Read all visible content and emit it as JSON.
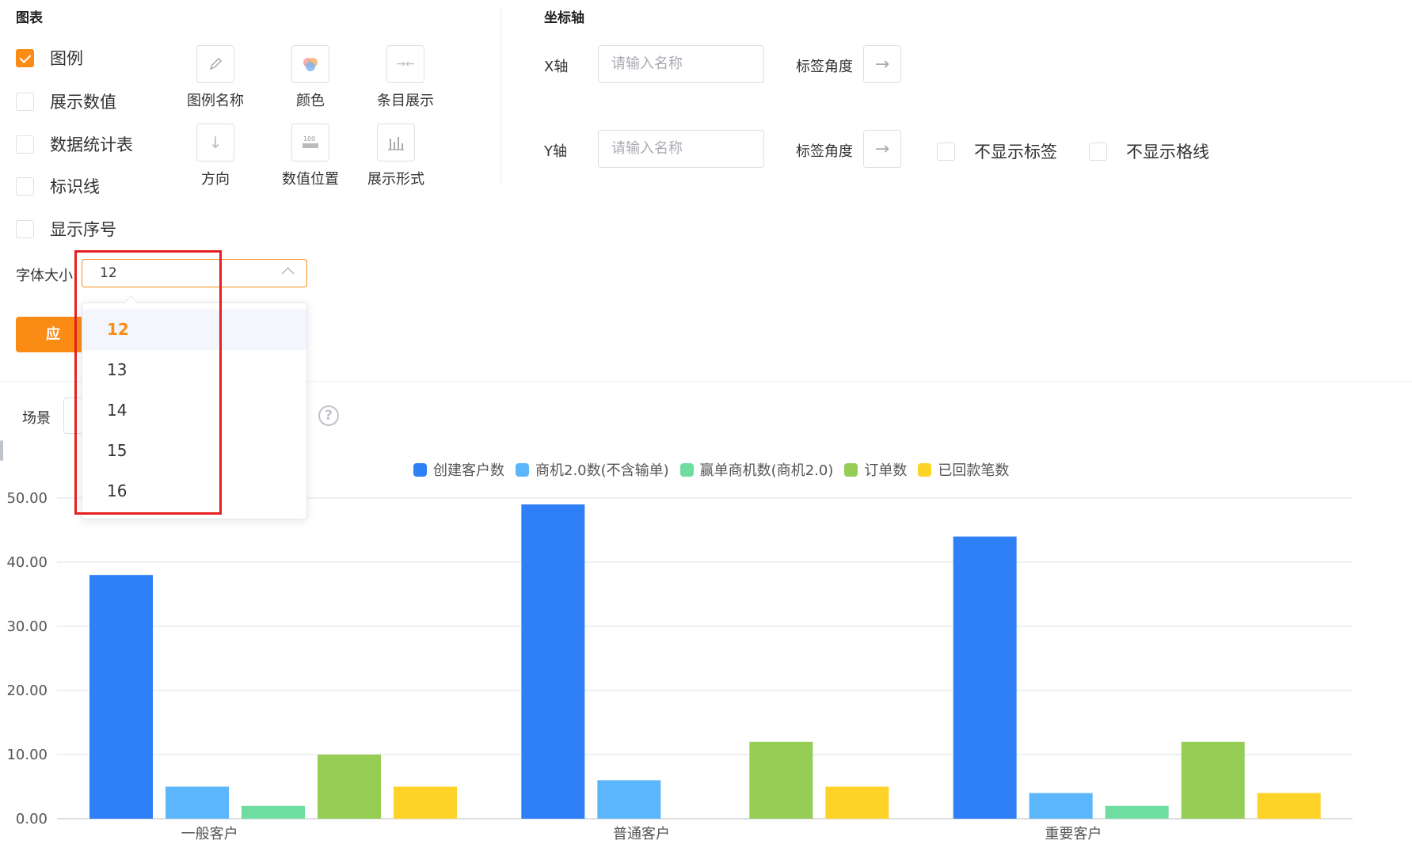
{
  "chart_section": {
    "title": "图表",
    "checkboxes": [
      {
        "label": "图例",
        "checked": true
      },
      {
        "label": "展示数值",
        "checked": false
      },
      {
        "label": "数据统计表",
        "checked": false
      },
      {
        "label": "标识线",
        "checked": false
      },
      {
        "label": "显示序号",
        "checked": false
      }
    ],
    "tools": [
      {
        "label": "图例名称",
        "icon": "pencil-icon"
      },
      {
        "label": "颜色",
        "icon": "color-palette-icon"
      },
      {
        "label": "条目展示",
        "icon": "compress-arrows-icon"
      },
      {
        "label": "方向",
        "icon": "arrow-down-icon"
      },
      {
        "label": "数值位置",
        "icon": "value-position-icon"
      },
      {
        "label": "展示形式",
        "icon": "bar-chart-icon"
      }
    ],
    "font_size_label": "字体大小",
    "font_size_value": "12",
    "font_size_options": [
      "12",
      "13",
      "14",
      "15",
      "16"
    ],
    "apply_label": "应 用"
  },
  "axis_section": {
    "title": "坐标轴",
    "x_label": "X轴",
    "y_label": "Y轴",
    "name_placeholder": "请输入名称",
    "tick_angle_label": "标签角度",
    "hide_labels": "不显示标签",
    "hide_gridlines": "不显示格线"
  },
  "scene_label": "场景",
  "colors": {
    "accent": "#fa8c16",
    "highlight": "#e62020"
  },
  "chart_data": {
    "type": "bar",
    "categories": [
      "一般客户",
      "普通客户",
      "重要客户"
    ],
    "series": [
      {
        "name": "创建客户数",
        "color": "#2f7ff6",
        "values": [
          38,
          49,
          44
        ]
      },
      {
        "name": "商机2.0数(不含输单)",
        "color": "#5bb6fb",
        "values": [
          5,
          6,
          4
        ]
      },
      {
        "name": "赢单商机数(商机2.0)",
        "color": "#6fdca0",
        "values": [
          2,
          0,
          2
        ]
      },
      {
        "name": "订单数",
        "color": "#95cd55",
        "values": [
          10,
          12,
          12
        ]
      },
      {
        "name": "已回款笔数",
        "color": "#fdd327",
        "values": [
          5,
          5,
          4
        ]
      }
    ],
    "ylim": [
      0,
      50
    ],
    "yticks": [
      "0.00",
      "10.00",
      "20.00",
      "30.00",
      "40.00",
      "50.00"
    ],
    "legend_position": "top-center",
    "grid": true
  }
}
